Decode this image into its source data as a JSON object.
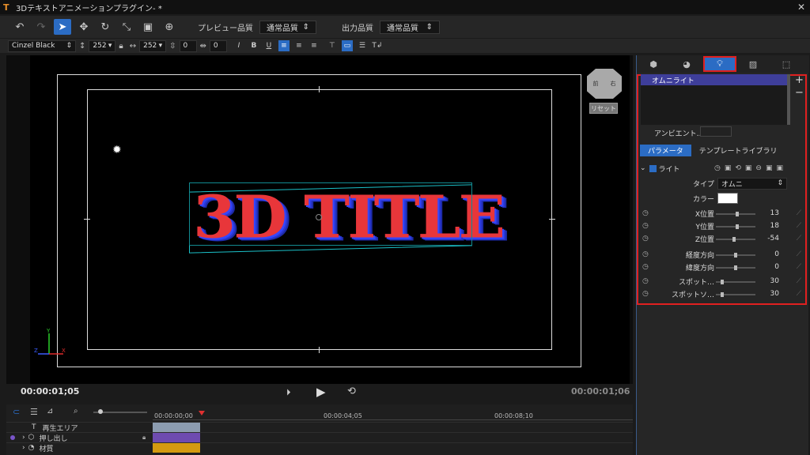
{
  "window": {
    "title": "3Dテキストアニメーションプラグイン- *",
    "close": "✕"
  },
  "toolbar": {
    "preview_label": "プレビュー品質",
    "preview_value": "通常品質",
    "output_label": "出力品質",
    "output_value": "通常品質"
  },
  "format_bar": {
    "font": "Cinzel Black",
    "size": "252",
    "width": "252",
    "spacing1": "0",
    "spacing2": "0"
  },
  "viewport": {
    "nav_cube_left": "前",
    "nav_cube_right": "右",
    "reset_label": "リセット",
    "title_text": "3D TITLE",
    "axis_x": "X",
    "axis_y": "Y",
    "axis_z": "Z"
  },
  "playback": {
    "current_time": "00:00:01;05",
    "end_time": "00:00:01;06"
  },
  "timeline": {
    "ruler": [
      "00:00:00;00",
      "00:00:04;05",
      "00:00:08;10"
    ],
    "tracks": [
      {
        "name": "再生エリア",
        "color": "#8c9cb0",
        "icon": "text-icon"
      },
      {
        "name": "押し出し",
        "color": "#6e4bb0",
        "icon": "cube-icon"
      },
      {
        "name": "材質",
        "color": "#d49a10",
        "icon": "material-icon"
      }
    ],
    "zoom_level": 0.1
  },
  "panel": {
    "light_list": [
      "オムニライト"
    ],
    "add": "+",
    "remove": "−",
    "ambient_label": "アンビエント…",
    "tabs": {
      "params": "パラメータ",
      "library": "テンプレートライブラリ"
    },
    "section": "ライト",
    "type_label": "タイプ",
    "type_value": "オムニ",
    "color_label": "カラー",
    "params": [
      {
        "label": "X位置",
        "value": "13",
        "knob": 0.55
      },
      {
        "label": "Y位置",
        "value": "18",
        "knob": 0.55
      },
      {
        "label": "Z位置",
        "value": "-54",
        "knob": 0.45
      },
      {
        "label": "経度方向",
        "value": "0",
        "knob": 0.5
      },
      {
        "label": "緯度方向",
        "value": "0",
        "knob": 0.5
      },
      {
        "label": "スポット…",
        "value": "30",
        "knob": 0.12
      },
      {
        "label": "スポットソ…",
        "value": "30",
        "knob": 0.12
      }
    ]
  },
  "colors": {
    "accent": "#2b6cc4",
    "highlight_box": "#e02020",
    "bbox": "#1bc1c9",
    "title_face": "#e8363a",
    "title_side": "#3546ff"
  }
}
